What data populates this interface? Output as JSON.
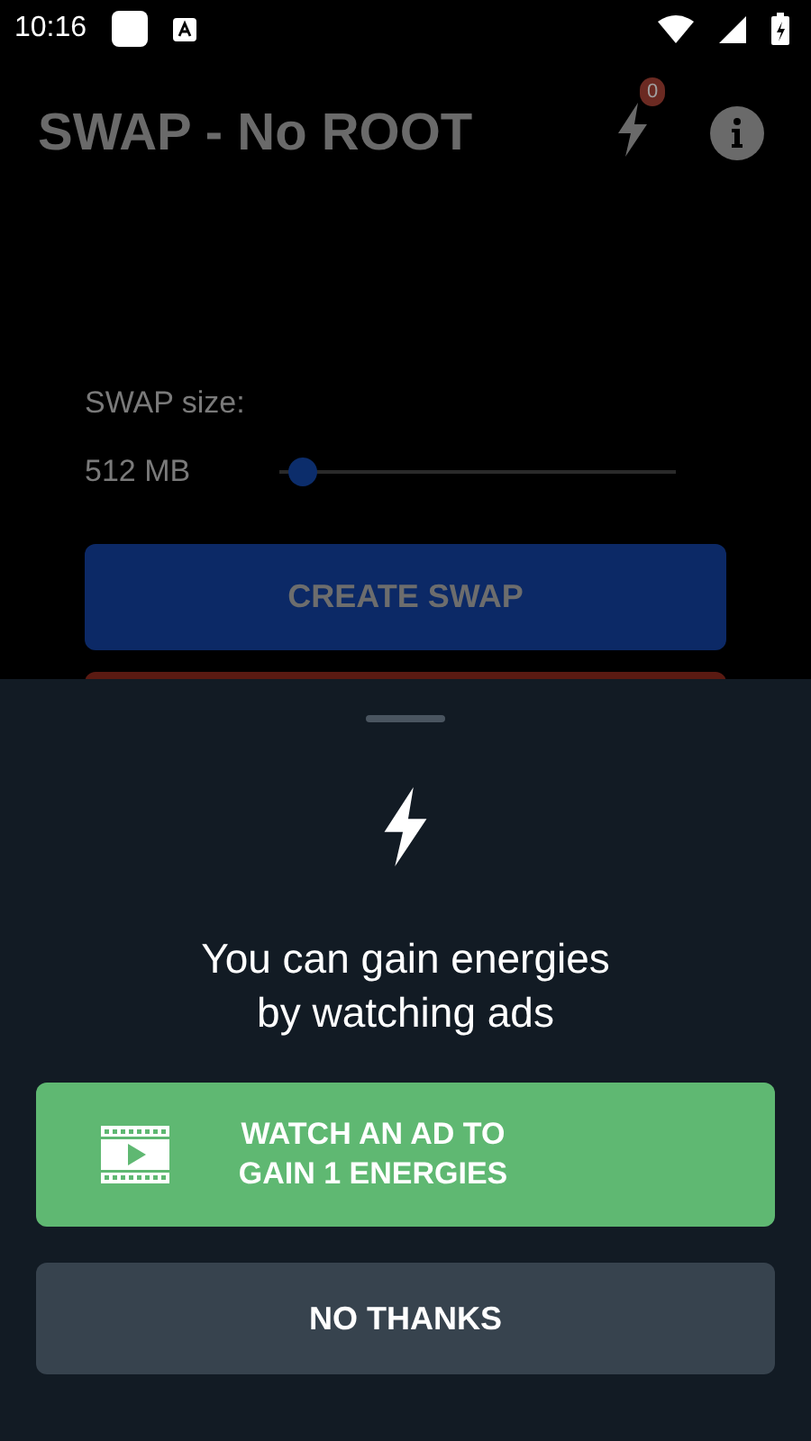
{
  "status_bar": {
    "time": "10:16"
  },
  "app_bar": {
    "title": "SWAP - No ROOT",
    "energy_count": "0"
  },
  "swap": {
    "label": "SWAP size:",
    "value": "512 MB",
    "level": 0.06,
    "create_button": "CREATE SWAP"
  },
  "sheet": {
    "message_line_1": "You can gain energies",
    "message_line_2": "by watching ads",
    "watch_button_line_1": "WATCH AN AD TO",
    "watch_button_line_2": "GAIN 1 ENERGIES",
    "dismiss_button": "NO THANKS"
  }
}
